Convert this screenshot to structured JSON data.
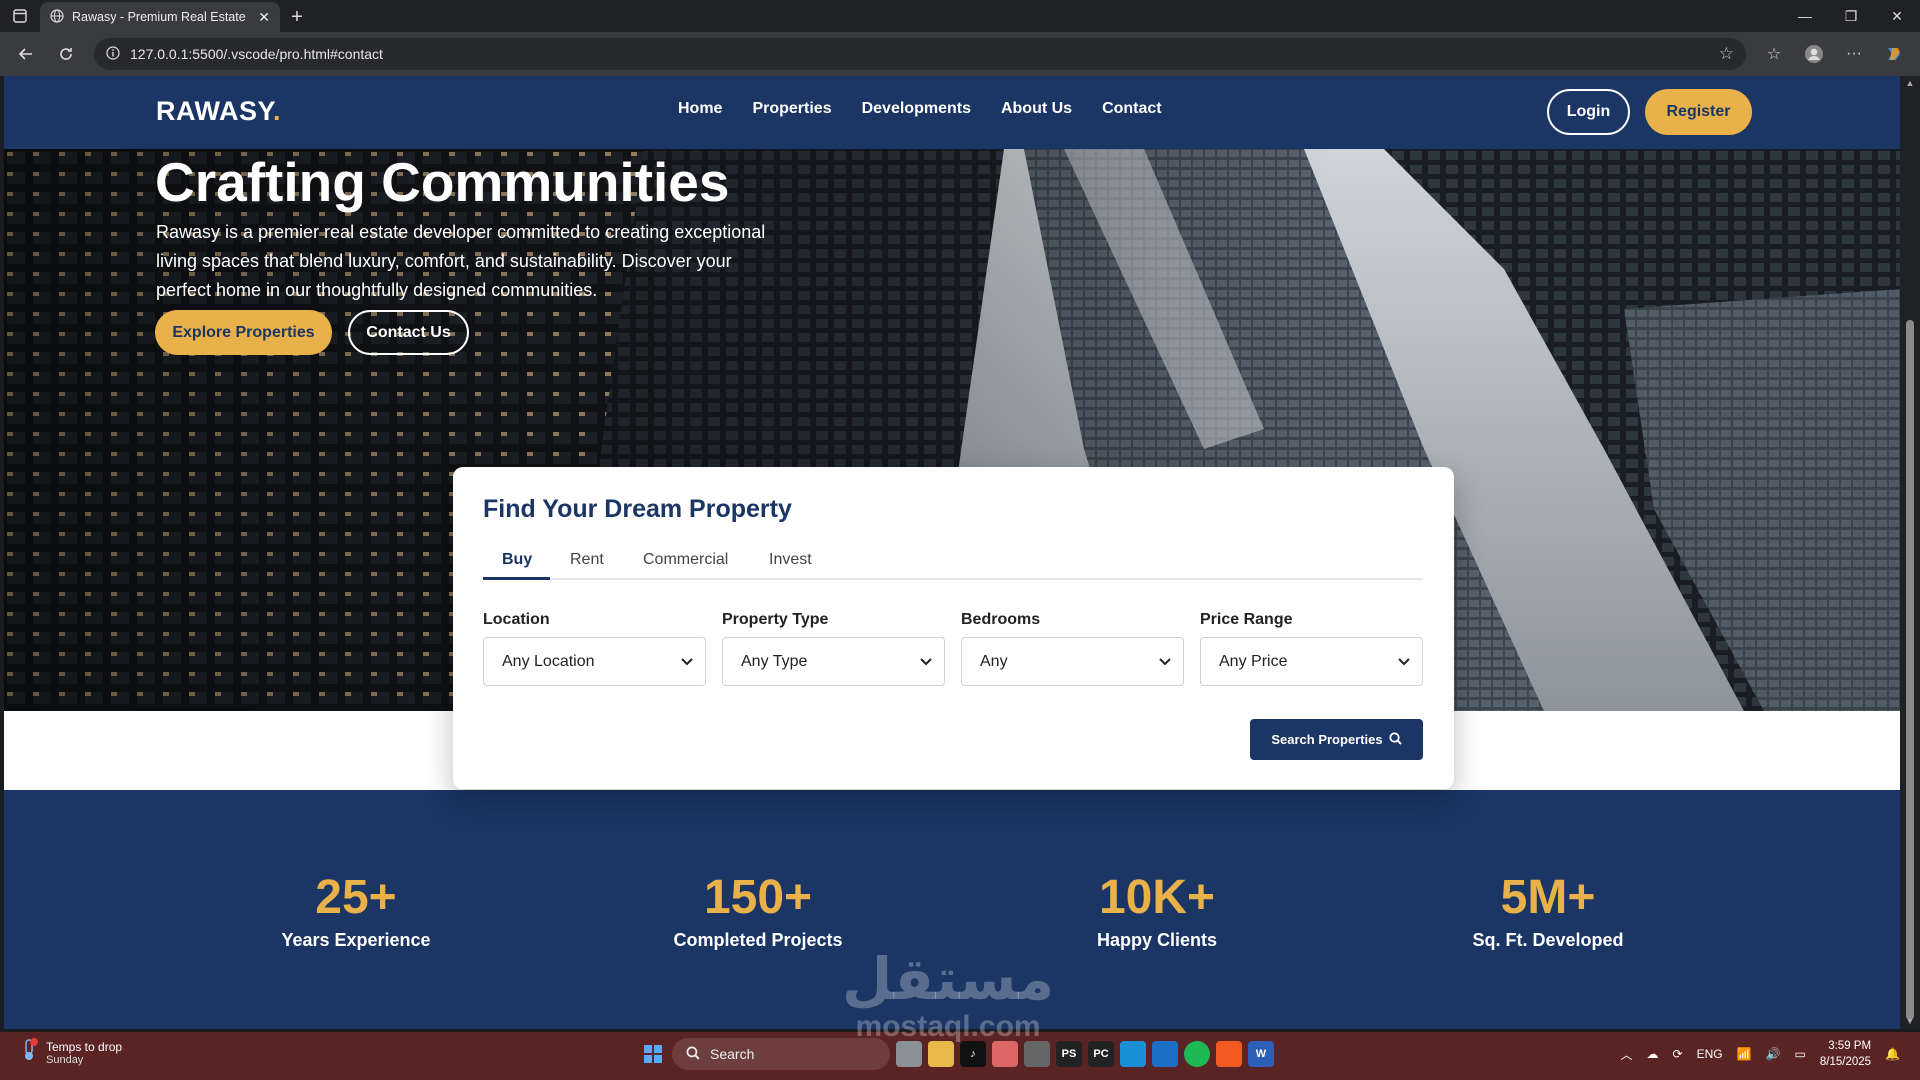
{
  "browser": {
    "tab_title": "Rawasy - Premium Real Estate De",
    "url": "127.0.0.1:5500/.vscode/pro.html#contact"
  },
  "site": {
    "logo": "RAWASY",
    "logo_dot": ".",
    "nav": [
      "Home",
      "Properties",
      "Developments",
      "About Us",
      "Contact"
    ],
    "login": "Login",
    "register": "Register",
    "colors": {
      "navy": "#1b3564",
      "gold": "#e8b14a"
    }
  },
  "hero": {
    "title": "Crafting Communities",
    "description": "Rawasy is a premier real estate developer committed to creating exceptional living spaces that blend luxury, comfort, and sustainability. Discover your perfect home in our thoughtfully designed communities.",
    "explore_button": "Explore Properties",
    "contact_button": "Contact Us"
  },
  "search": {
    "title": "Find Your Dream Property",
    "tabs": [
      "Buy",
      "Rent",
      "Commercial",
      "Invest"
    ],
    "active_tab": "Buy",
    "fields": [
      {
        "label": "Location",
        "value": "Any Location"
      },
      {
        "label": "Property Type",
        "value": "Any Type"
      },
      {
        "label": "Bedrooms",
        "value": "Any"
      },
      {
        "label": "Price Range",
        "value": "Any Price"
      }
    ],
    "button": "Search Properties"
  },
  "stats": [
    {
      "number": "25+",
      "label": "Years Experience"
    },
    {
      "number": "150+",
      "label": "Completed Projects"
    },
    {
      "number": "10K+",
      "label": "Happy Clients"
    },
    {
      "number": "5M+",
      "label": "Sq. Ft. Developed"
    }
  ],
  "taskbar": {
    "weather_title": "Temps to drop",
    "weather_sub": "Sunday",
    "search_placeholder": "Search",
    "lang": "ENG",
    "time": "3:59 PM",
    "date": "8/15/2025"
  },
  "watermark": {
    "arabic": "مستقل",
    "latin": "mostaql.com"
  }
}
